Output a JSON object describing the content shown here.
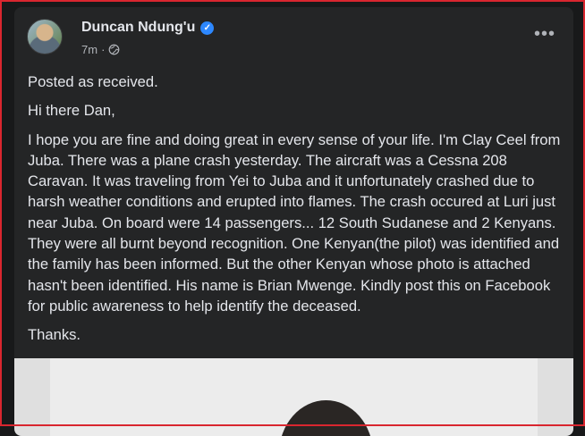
{
  "post": {
    "author": "Duncan Ndung'u",
    "verified_icon": "verified-badge-icon",
    "time": "7m",
    "separator": "·",
    "audience_icon": "globe-icon",
    "more_label": "•••",
    "paragraphs": [
      "Posted as received.",
      "Hi there Dan,",
      "I hope you are fine and doing great in every sense of your life. I'm Clay Ceel from Juba. There was a plane crash yesterday. The aircraft was a Cessna 208 Caravan. It was traveling from Yei to Juba and it unfortunately crashed due to harsh weather conditions and erupted into flames. The crash occured at Luri just near Juba. On board were 14 passengers... 12 South Sudanese and 2 Kenyans. They were all burnt beyond recognition. One Kenyan(the pilot) was identified and the family has been informed. But the other Kenyan whose photo is attached hasn't been identified. His name is Brian Mwenge. Kindly post this on Facebook for public awareness to help identify the deceased.",
      "Thanks."
    ]
  },
  "colors": {
    "background": "#18191a",
    "card": "#242526",
    "text_primary": "#e4e6eb",
    "text_secondary": "#b0b3b8",
    "verified": "#2d88ff",
    "frame": "#d9262f"
  }
}
